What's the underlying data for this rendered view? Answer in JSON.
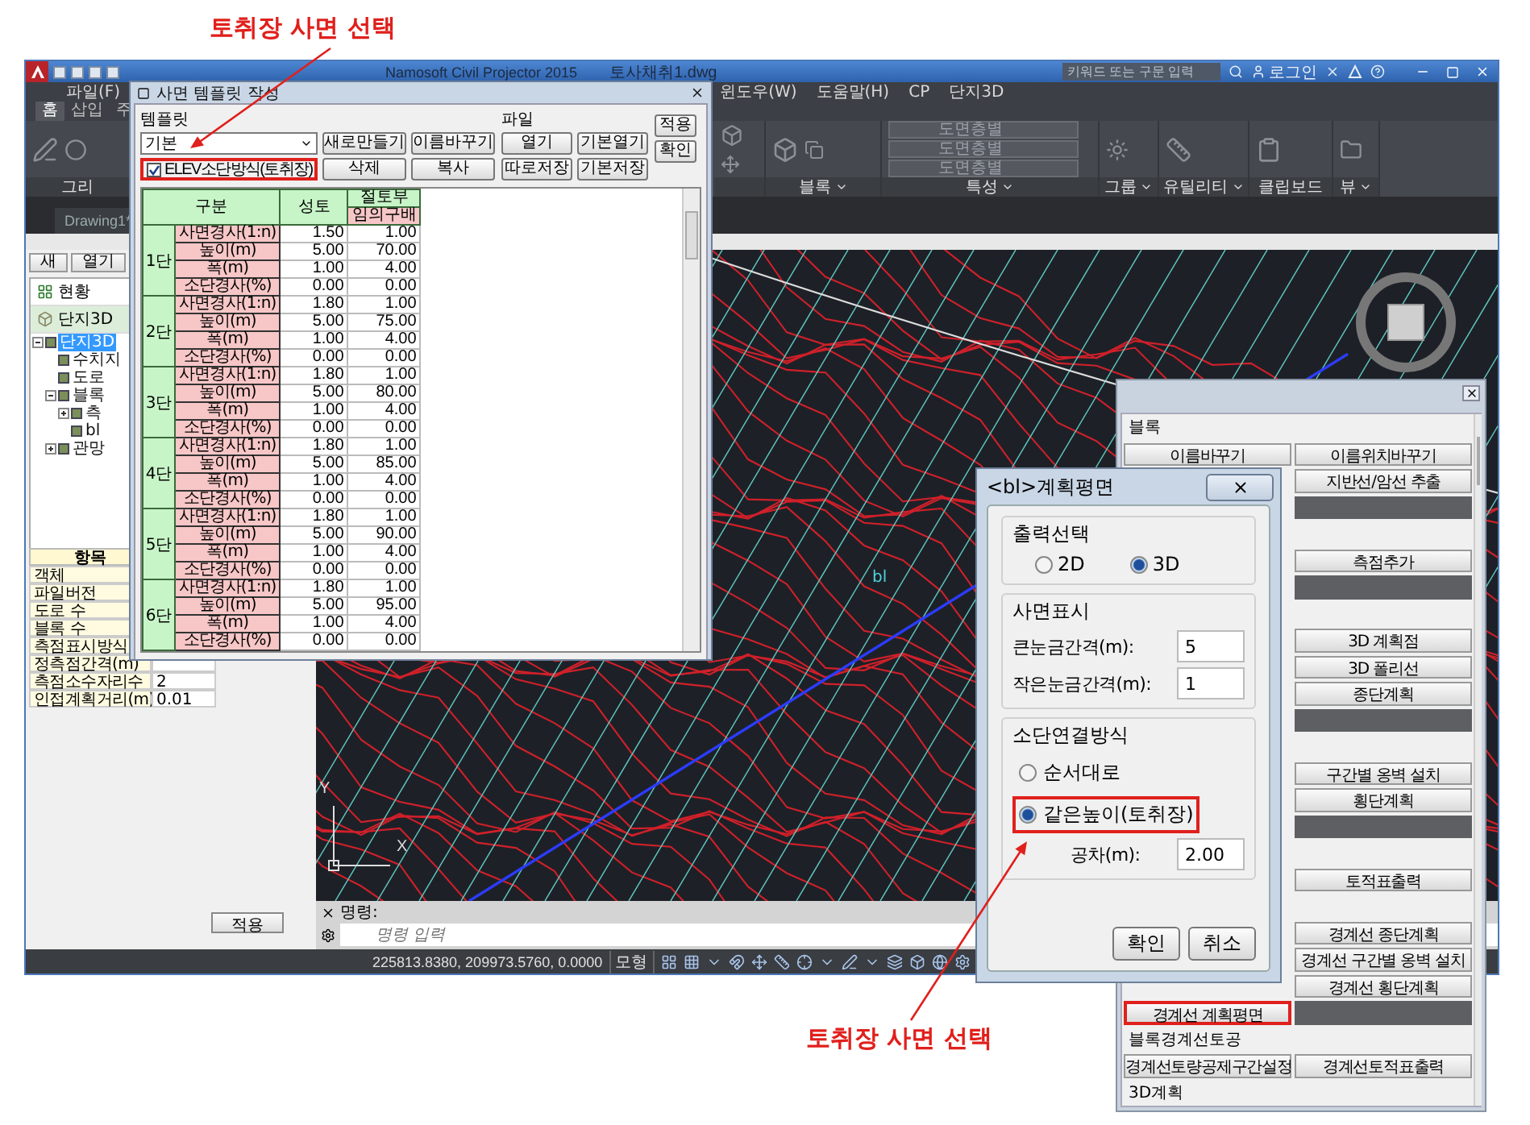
{
  "annotations": [
    {
      "text": "토취장 사면 선택"
    },
    {
      "text": "토취장 사면 선택"
    }
  ],
  "app": {
    "title": "Namosoft Civil Projector 2015",
    "file": "토사채취1.dwg",
    "search_placeholder": "키워드 또는 구문 입력",
    "login": "로그인",
    "menu": [
      "파일(F)",
      "윈도우(W)",
      "도움말(H)",
      "CP",
      "단지3D"
    ],
    "ribbon_tabs": [
      {
        "label": "홈",
        "selected": true
      },
      {
        "label": "삽입",
        "selected": false
      },
      {
        "label": "주",
        "selected": false
      }
    ],
    "ribbon_panels": [
      {
        "label": "그리",
        "menu": false
      },
      {
        "label": "블록",
        "menu": true
      },
      {
        "label": "특성",
        "menu": true
      },
      {
        "label": "그룹",
        "menu": true
      },
      {
        "label": "유틸리티",
        "menu": true
      },
      {
        "label": "클립보드",
        "menu": false
      },
      {
        "label": "뷰",
        "menu": true
      }
    ],
    "layer_fields": [
      "도면층별",
      "도면층별",
      "도면층별"
    ],
    "document_tab": "Drawing1*",
    "left_panel": {
      "buttons": [
        "새",
        "열기"
      ],
      "sections": [
        "현황",
        "단지3D"
      ],
      "tree": [
        {
          "label": "단지3D",
          "selected": true,
          "expanded": true,
          "children": [
            {
              "label": "수치지",
              "selected": false
            },
            {
              "label": "도로",
              "selected": false
            },
            {
              "label": "블록",
              "selected": false,
              "expanded": true,
              "children": [
                {
                  "label": "측",
                  "selected": false,
                  "expanded": false
                },
                {
                  "label": "bl",
                  "selected": false
                }
              ]
            },
            {
              "label": "관망",
              "selected": false,
              "expanded": false
            }
          ]
        }
      ],
      "properties": {
        "header": "항목",
        "rows": [
          {
            "name": "객체"
          },
          {
            "name": "파일버전"
          },
          {
            "name": "도로 수"
          },
          {
            "name": "블록 수"
          },
          {
            "name": "측점표시방식"
          },
          {
            "name": "정측점간격(m)"
          },
          {
            "name": "측점소수자리수",
            "value": "2"
          },
          {
            "name": "인접계획거리(m)",
            "value": "0.01"
          }
        ]
      },
      "apply": "적용"
    },
    "canvas": {
      "label": "bl",
      "axes": [
        "X",
        "Y"
      ]
    },
    "command": {
      "label": "명령:",
      "placeholder": "명령 입력"
    },
    "status": {
      "coordinates": "225813.8380, 209973.5760, 0.0000",
      "mode": "모형"
    }
  },
  "template_dialog": {
    "title": "사면 템플릿 작성",
    "template_label": "템플릿",
    "template": "기본",
    "buttons": [
      "새로만들기",
      "이름바꾸기",
      "삭제",
      "복사"
    ],
    "file_label": "파일",
    "file_buttons": [
      "열기",
      "기본열기",
      "따로저장",
      "기본저장"
    ],
    "side_buttons": [
      "적용",
      "확인"
    ],
    "elev_checkbox": {
      "label": "ELEV소단방식(토취장)",
      "checked": true,
      "highlighted": true
    },
    "table": {
      "columns": [
        "구분",
        "성토",
        "절토부"
      ],
      "subheader": "임의구배",
      "groups": [
        {
          "name": "1단",
          "rows": [
            {
              "label": "사면경사(1:n)",
              "fill": "1.50",
              "cut": "1.00"
            },
            {
              "label": "높이(m)",
              "fill": "5.00",
              "cut": "70.00"
            },
            {
              "label": "폭(m)",
              "fill": "1.00",
              "cut": "4.00"
            },
            {
              "label": "소단경사(%)",
              "fill": "0.00",
              "cut": "0.00"
            }
          ]
        },
        {
          "name": "2단",
          "rows": [
            {
              "label": "사면경사(1:n)",
              "fill": "1.80",
              "cut": "1.00"
            },
            {
              "label": "높이(m)",
              "fill": "5.00",
              "cut": "75.00"
            },
            {
              "label": "폭(m)",
              "fill": "1.00",
              "cut": "4.00"
            },
            {
              "label": "소단경사(%)",
              "fill": "0.00",
              "cut": "0.00"
            }
          ]
        },
        {
          "name": "3단",
          "rows": [
            {
              "label": "사면경사(1:n)",
              "fill": "1.80",
              "cut": "1.00"
            },
            {
              "label": "높이(m)",
              "fill": "5.00",
              "cut": "80.00"
            },
            {
              "label": "폭(m)",
              "fill": "1.00",
              "cut": "4.00"
            },
            {
              "label": "소단경사(%)",
              "fill": "0.00",
              "cut": "0.00"
            }
          ]
        },
        {
          "name": "4단",
          "rows": [
            {
              "label": "사면경사(1:n)",
              "fill": "1.80",
              "cut": "1.00"
            },
            {
              "label": "높이(m)",
              "fill": "5.00",
              "cut": "85.00"
            },
            {
              "label": "폭(m)",
              "fill": "1.00",
              "cut": "4.00"
            },
            {
              "label": "소단경사(%)",
              "fill": "0.00",
              "cut": "0.00"
            }
          ]
        },
        {
          "name": "5단",
          "rows": [
            {
              "label": "사면경사(1:n)",
              "fill": "1.80",
              "cut": "1.00"
            },
            {
              "label": "높이(m)",
              "fill": "5.00",
              "cut": "90.00"
            },
            {
              "label": "폭(m)",
              "fill": "1.00",
              "cut": "4.00"
            },
            {
              "label": "소단경사(%)",
              "fill": "0.00",
              "cut": "0.00"
            }
          ]
        },
        {
          "name": "6단",
          "rows": [
            {
              "label": "사면경사(1:n)",
              "fill": "1.80",
              "cut": "1.00"
            },
            {
              "label": "높이(m)",
              "fill": "5.00",
              "cut": "95.00"
            },
            {
              "label": "폭(m)",
              "fill": "1.00",
              "cut": "4.00"
            },
            {
              "label": "소단경사(%)",
              "fill": "0.00",
              "cut": "0.00"
            }
          ]
        }
      ]
    }
  },
  "plan_dialog": {
    "title": "<bl>계획평면",
    "output": {
      "label": "출력선택",
      "options": [
        {
          "label": "2D",
          "selected": false
        },
        {
          "label": "3D",
          "selected": true
        }
      ]
    },
    "slope": {
      "label": "사면표시",
      "fields": [
        {
          "label": "큰눈금간격(m):",
          "value": "5"
        },
        {
          "label": "작은눈금간격(m):",
          "value": "1"
        }
      ]
    },
    "connection": {
      "label": "소단연결방식",
      "options": [
        {
          "label": "순서대로",
          "selected": false,
          "highlighted": false
        },
        {
          "label": "같은높이(토취장)",
          "selected": true,
          "highlighted": true
        }
      ],
      "tolerance": {
        "label": "공차(m):",
        "value": "2.00"
      }
    },
    "buttons": [
      "확인",
      "취소"
    ]
  },
  "block_panel": {
    "rows": [
      {
        "kind": "heading",
        "label": "블록"
      },
      {
        "kind": "pair",
        "cells": [
          {
            "kind": "button",
            "label": "이름바꾸기"
          },
          {
            "kind": "button",
            "label": "이름위치바꾸기"
          }
        ]
      },
      {
        "kind": "pair",
        "cells": [
          {
            "kind": "blank"
          },
          {
            "kind": "button",
            "label": "지반선/암선 추출"
          }
        ]
      },
      {
        "kind": "pair",
        "cells": [
          {
            "kind": "blank"
          },
          {
            "kind": "bar"
          }
        ]
      },
      {
        "kind": "pair",
        "cells": [
          {
            "kind": "blank"
          },
          {
            "kind": "blank"
          }
        ]
      },
      {
        "kind": "pair",
        "cells": [
          {
            "kind": "blank"
          },
          {
            "kind": "button",
            "label": "측점추가"
          }
        ]
      },
      {
        "kind": "pair",
        "cells": [
          {
            "kind": "blank"
          },
          {
            "kind": "bar"
          }
        ]
      },
      {
        "kind": "pair",
        "cells": [
          {
            "kind": "blank"
          },
          {
            "kind": "blank"
          }
        ]
      },
      {
        "kind": "pair",
        "cells": [
          {
            "kind": "blank"
          },
          {
            "kind": "button",
            "label": "3D 계획점"
          }
        ]
      },
      {
        "kind": "pair",
        "cells": [
          {
            "kind": "blank"
          },
          {
            "kind": "button",
            "label": "3D 폴리선"
          }
        ]
      },
      {
        "kind": "pair",
        "cells": [
          {
            "kind": "blank"
          },
          {
            "kind": "button",
            "label": "종단계획"
          }
        ]
      },
      {
        "kind": "pair",
        "cells": [
          {
            "kind": "blank"
          },
          {
            "kind": "bar"
          }
        ]
      },
      {
        "kind": "pair",
        "cells": [
          {
            "kind": "blank"
          },
          {
            "kind": "blank"
          }
        ]
      },
      {
        "kind": "pair",
        "cells": [
          {
            "kind": "blank"
          },
          {
            "kind": "button",
            "label": "구간별 옹벽 설치"
          }
        ]
      },
      {
        "kind": "pair",
        "cells": [
          {
            "kind": "blank"
          },
          {
            "kind": "button",
            "label": "횡단계획"
          }
        ]
      },
      {
        "kind": "pair",
        "cells": [
          {
            "kind": "blank"
          },
          {
            "kind": "bar"
          }
        ]
      },
      {
        "kind": "pair",
        "cells": [
          {
            "kind": "blank"
          },
          {
            "kind": "blank"
          }
        ]
      },
      {
        "kind": "pair",
        "cells": [
          {
            "kind": "blank"
          },
          {
            "kind": "button",
            "label": "토적표출력"
          }
        ]
      },
      {
        "kind": "pair",
        "cells": [
          {
            "kind": "blank"
          },
          {
            "kind": "blank"
          }
        ]
      },
      {
        "kind": "pair",
        "cells": [
          {
            "kind": "blank"
          },
          {
            "kind": "button",
            "label": "경계선 종단계획"
          }
        ]
      },
      {
        "kind": "pair",
        "cells": [
          {
            "kind": "blank"
          },
          {
            "kind": "button",
            "label": "경계선 구간별 옹벽 설치"
          }
        ]
      },
      {
        "kind": "pair",
        "cells": [
          {
            "kind": "blank"
          },
          {
            "kind": "button",
            "label": "경계선 횡단계획"
          }
        ]
      },
      {
        "kind": "pair",
        "cells": [
          {
            "kind": "button",
            "label": "경계선 계획평면",
            "highlighted": true
          },
          {
            "kind": "bar"
          }
        ]
      },
      {
        "kind": "heading",
        "label": "블록경계선토공"
      },
      {
        "kind": "pair",
        "cells": [
          {
            "kind": "button",
            "label": "경계선토량공제구간설정"
          },
          {
            "kind": "button",
            "label": "경계선토적표출력"
          }
        ]
      },
      {
        "kind": "heading",
        "label": "3D계획"
      }
    ]
  }
}
